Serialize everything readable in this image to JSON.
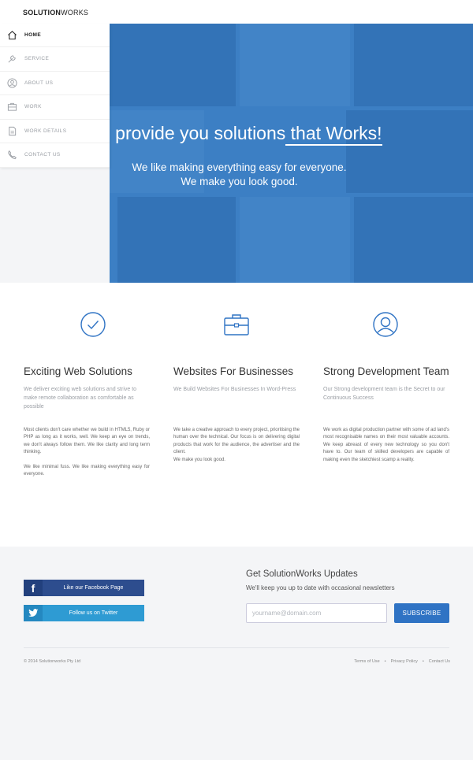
{
  "brand": {
    "name_bold": "SOLUTION",
    "name_light": "WORKS"
  },
  "sidebar": {
    "items": [
      {
        "label": "HOME",
        "icon": "home-icon"
      },
      {
        "label": "SERVICE",
        "icon": "wrench-icon"
      },
      {
        "label": "ABOUT US",
        "icon": "user-circle-icon"
      },
      {
        "label": "WORK",
        "icon": "briefcase-icon"
      },
      {
        "label": "WORK DETAILS",
        "icon": "document-icon"
      },
      {
        "label": "CONTACT US",
        "icon": "phone-icon"
      }
    ]
  },
  "hero": {
    "title_start": "e provide you solutions",
    "title_highlight": " that Works!",
    "subtitle_line1": "We like making everything easy for everyone.",
    "subtitle_line2": "We make you look good.",
    "overlay_color": "#3c7fc4"
  },
  "features": [
    {
      "icon": "check-circle-icon",
      "title": "Exciting Web Solutions",
      "intro": "We deliver exciting web solutions and strive to make remote collaboration as comfortable as possible",
      "body1": "Most clients don't care whether we build in HTML5, Ruby or PHP as long as it works, well. We keep an eye on trends, we don't always follow them. We like clarity and long term thinking.",
      "body2": "We like minimal fuss. We like making everything easy for everyone."
    },
    {
      "icon": "briefcase-icon",
      "title": "Websites For Businesses",
      "intro": "We Build Websites For Businesses In Word-Press",
      "body1": "We take a creative approach to every project, prioritising the human over the technical. Our focus is on delivering digital products that work for the audience, the advertiser and the client.",
      "body2": "We make you look good."
    },
    {
      "icon": "user-circle-icon",
      "title": "Strong Development Team",
      "intro": "Our Strong development team is the Secret to our Continuous Success",
      "body1": "We work as digital production partner with some of ad land's most recognisable names on their most valuable accounts. We keep abreast of every new technology so you don't have to. Our team of skilled developers are capable of making even the sketchiest scamp a reality.",
      "body2": ""
    }
  ],
  "footer": {
    "facebook_label": "Like our Facebook Page",
    "twitter_label": "Follow us on Twitter",
    "newsletter_title": "Get SolutionWorks Updates",
    "newsletter_sub": "We'll keep you up to date with occasional newsletters",
    "email_placeholder": "yourname@domain.com",
    "subscribe_label": "SUBSCRIBE",
    "copyright": "© 2014 Solutionworks Pty Ltd",
    "links": [
      "Terms of Use",
      "Privacy Policy",
      "Contact Us"
    ],
    "accent_color": "#2f73c4"
  }
}
